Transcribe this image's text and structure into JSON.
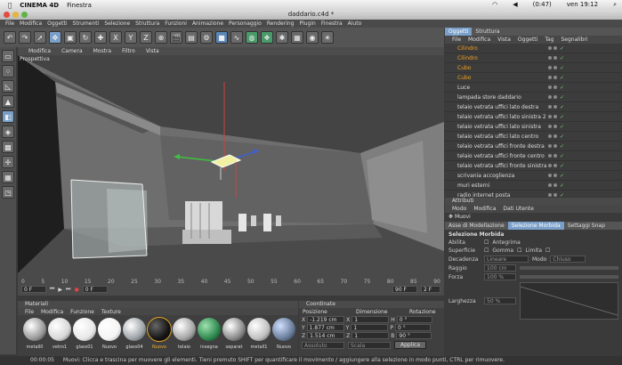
{
  "mac_menubar": {
    "app": "CINEMA 4D",
    "menu": "Finestra",
    "battery": "(0:47)",
    "clock": "ven 19:12"
  },
  "window": {
    "title": "daddario.c4d *"
  },
  "app_menu": [
    "File",
    "Modifica",
    "Oggetti",
    "Strumenti",
    "Selezione",
    "Struttura",
    "Funzioni",
    "Animazione",
    "Personaggio",
    "Rendering",
    "Plugin",
    "Finestra",
    "Aiuto"
  ],
  "viewport": {
    "menu": [
      "Modifica",
      "Camera",
      "Mostra",
      "Filtro",
      "Vista"
    ],
    "label": "Prospettiva"
  },
  "timeline": {
    "ticks": [
      "0",
      "5",
      "10",
      "15",
      "20",
      "25",
      "30",
      "35",
      "40",
      "45",
      "50",
      "55",
      "60",
      "65",
      "70",
      "75",
      "80",
      "85",
      "90"
    ],
    "start": "0 F",
    "end": "0 F",
    "frame_field": "90 F",
    "frame_right": "2 F"
  },
  "materials": {
    "title": "Materiali",
    "menu": [
      "File",
      "Modifica",
      "Funzione",
      "Texture"
    ],
    "items": [
      {
        "label": "metall0",
        "color": "#9a9a9a"
      },
      {
        "label": "vetro1",
        "color": "#d8d8d8"
      },
      {
        "label": "glass01",
        "color": "#e8e8e8"
      },
      {
        "label": "Nuovo",
        "color": "#f4f4f4"
      },
      {
        "label": "glass04",
        "color": "#9da3a8"
      },
      {
        "label": "Nuovo",
        "color": "#151515"
      },
      {
        "label": "telaio",
        "color": "#a6a6a6"
      },
      {
        "label": "insegna",
        "color": "#2f8a4f"
      },
      {
        "label": "separat",
        "color": "#8a8a8a"
      },
      {
        "label": "metall1",
        "color": "#c0c0c0"
      },
      {
        "label": "Nuovo",
        "color": "#6a7d9a"
      }
    ]
  },
  "coordinates": {
    "title": "Coordinate",
    "headers": [
      "Posizione",
      "Dimensione",
      "Rotazione"
    ],
    "rows": [
      {
        "axis": "X",
        "pos": "-1.219 cm",
        "axis2": "X",
        "dim": "1",
        "axis3": "H",
        "rot": "0 °"
      },
      {
        "axis": "Y",
        "pos": "1.877 cm",
        "axis2": "Y",
        "dim": "1",
        "axis3": "P",
        "rot": "0 °"
      },
      {
        "axis": "Z",
        "pos": "1.514 cm",
        "axis2": "Z",
        "dim": "1",
        "axis3": "B",
        "rot": "90 °"
      }
    ],
    "mode_left": "Assoluto",
    "mode_right": "Scala",
    "apply": "Applica"
  },
  "status": {
    "time": "00:00:05",
    "text": "Muovi: Clicca e trascina per muovere gli elementi. Tieni premuto SHIFT per quantificare il movimento / aggiungere alla selezione in modo punti, CTRL per rimuovere."
  },
  "objects": {
    "tabs": [
      "Oggetti",
      "Struttura"
    ],
    "menu": [
      "File",
      "Modifica",
      "Vista",
      "Oggetti",
      "Tag",
      "Segnalibri"
    ],
    "rows": [
      {
        "name": "Cilindro",
        "orange": true
      },
      {
        "name": "Cilindro",
        "orange": true
      },
      {
        "name": "Cubo",
        "orange": true
      },
      {
        "name": "Cubo",
        "orange": true
      },
      {
        "name": "Luce",
        "orange": false
      },
      {
        "name": "lampada store daddario",
        "orange": false
      },
      {
        "name": "telaio vetrata uffici lato destra",
        "orange": false
      },
      {
        "name": "telaio vetrata uffici lato sinistra 2",
        "orange": false
      },
      {
        "name": "telaio vetrata uffici lato sinistra",
        "orange": false
      },
      {
        "name": "telaio vetrata uffici lato centro",
        "orange": false
      },
      {
        "name": "telaio vetrata uffici fronte destra",
        "orange": false
      },
      {
        "name": "telaio vetrata uffici fronte centro",
        "orange": false
      },
      {
        "name": "telaio vetrata uffici fronte sinistra",
        "orange": false
      },
      {
        "name": "scrivania accoglienza",
        "orange": false
      },
      {
        "name": "muri esterni",
        "orange": false
      },
      {
        "name": "radio internet posta",
        "orange": false
      }
    ]
  },
  "attributes": {
    "title": "Attributi",
    "menu": [
      "Modo",
      "Modifica",
      "Dati Utente"
    ],
    "tool": "Muovi",
    "tabs": [
      "Asse di Modellazione",
      "Selezione Morbida",
      "Settaggi Snap"
    ],
    "section": "Selezione Morbida",
    "fields": [
      {
        "label": "Abilita",
        "value": "Antegrima"
      },
      {
        "label": "Superficie",
        "value": "Gomma"
      },
      {
        "label": "Limita",
        "value": ""
      },
      {
        "label": "Decadenza",
        "value": "Lineare"
      },
      {
        "label": "Modo",
        "value": "Chiuso"
      },
      {
        "label": "Raggio",
        "value": "100 cm"
      },
      {
        "label": "Forza",
        "value": "100 %"
      },
      {
        "label": "Larghezza",
        "value": "50 %"
      }
    ]
  }
}
